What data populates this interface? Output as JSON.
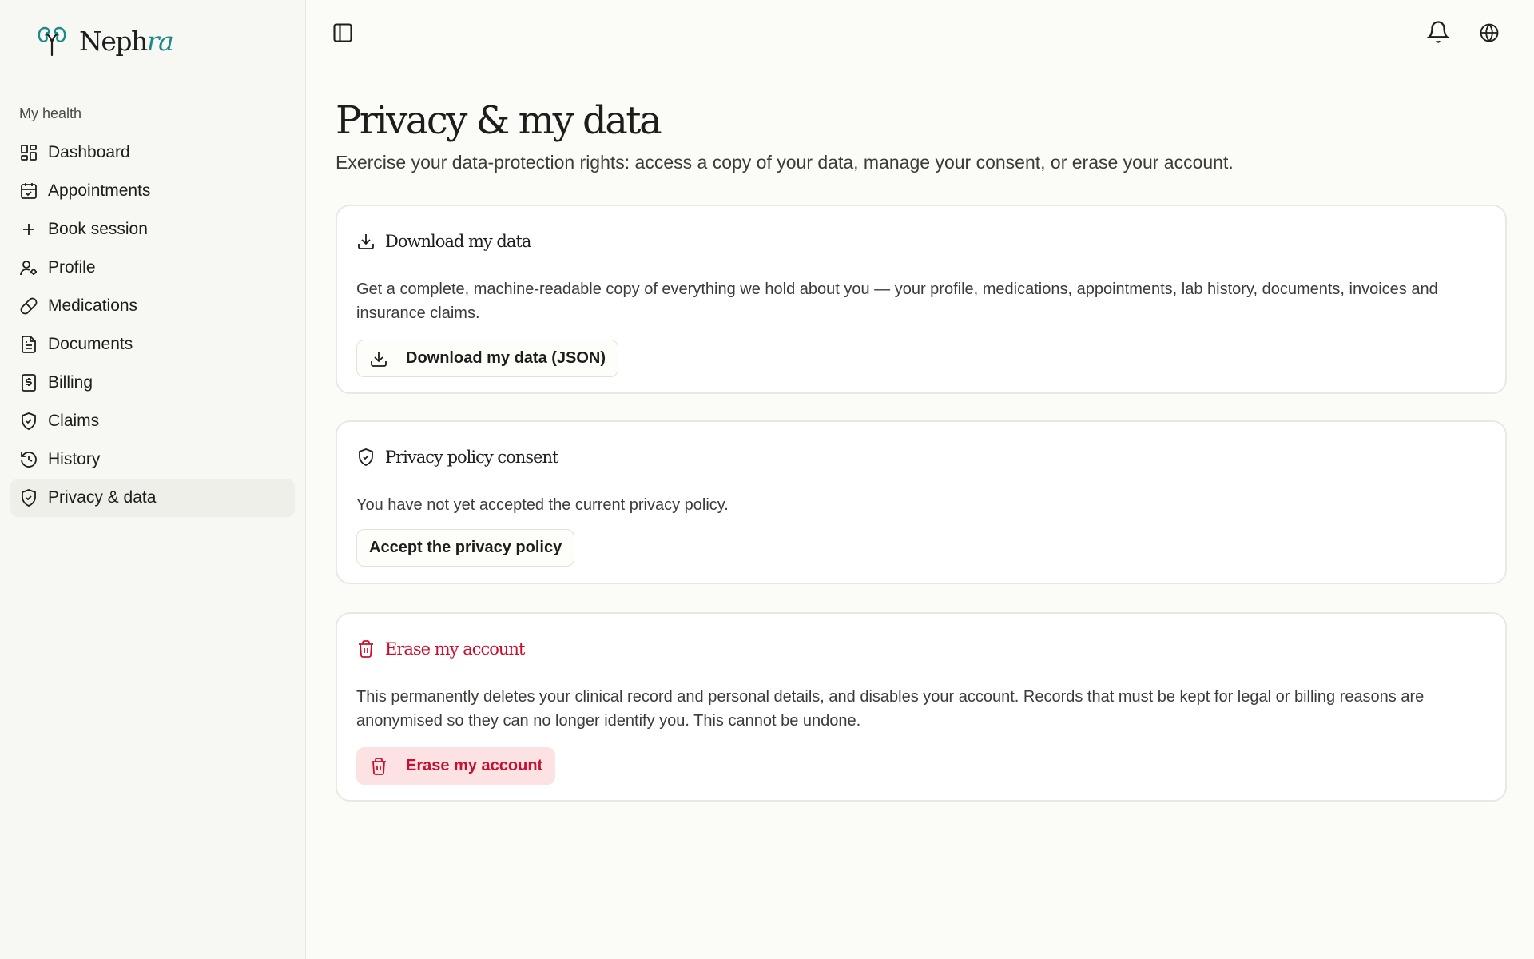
{
  "brand": {
    "name_main": "Neph",
    "name_accent": "ra"
  },
  "sidebar": {
    "section_label": "My health",
    "items": [
      {
        "label": "Dashboard",
        "icon": "dashboard-icon"
      },
      {
        "label": "Appointments",
        "icon": "calendar-icon"
      },
      {
        "label": "Book session",
        "icon": "plus-icon"
      },
      {
        "label": "Profile",
        "icon": "user-settings-icon"
      },
      {
        "label": "Medications",
        "icon": "pill-icon"
      },
      {
        "label": "Documents",
        "icon": "document-icon"
      },
      {
        "label": "Billing",
        "icon": "receipt-icon"
      },
      {
        "label": "Claims",
        "icon": "shield-check-icon"
      },
      {
        "label": "History",
        "icon": "history-icon"
      },
      {
        "label": "Privacy & data",
        "icon": "shield-check-icon",
        "active": true
      }
    ]
  },
  "page": {
    "title": "Privacy & my data",
    "subtitle": "Exercise your data-protection rights: access a copy of your data, manage your consent, or erase your account."
  },
  "cards": {
    "download": {
      "title": "Download my data",
      "body": "Get a complete, machine-readable copy of everything we hold about you — your profile, medications, appointments, lab history, documents, invoices and insurance claims.",
      "button": "Download my data (JSON)"
    },
    "consent": {
      "title": "Privacy policy consent",
      "body": "You have not yet accepted the current privacy policy.",
      "button": "Accept the privacy policy"
    },
    "erase": {
      "title": "Erase my account",
      "body": "This permanently deletes your clinical record and personal details, and disables your account. Records that must be kept for legal or billing reasons are anonymised so they can no longer identify you. This cannot be undone.",
      "button": "Erase my account"
    }
  },
  "colors": {
    "accent": "#1a8a88",
    "danger": "#c8102e",
    "danger_bg": "#fde2e4",
    "background": "#fbfbf7"
  }
}
